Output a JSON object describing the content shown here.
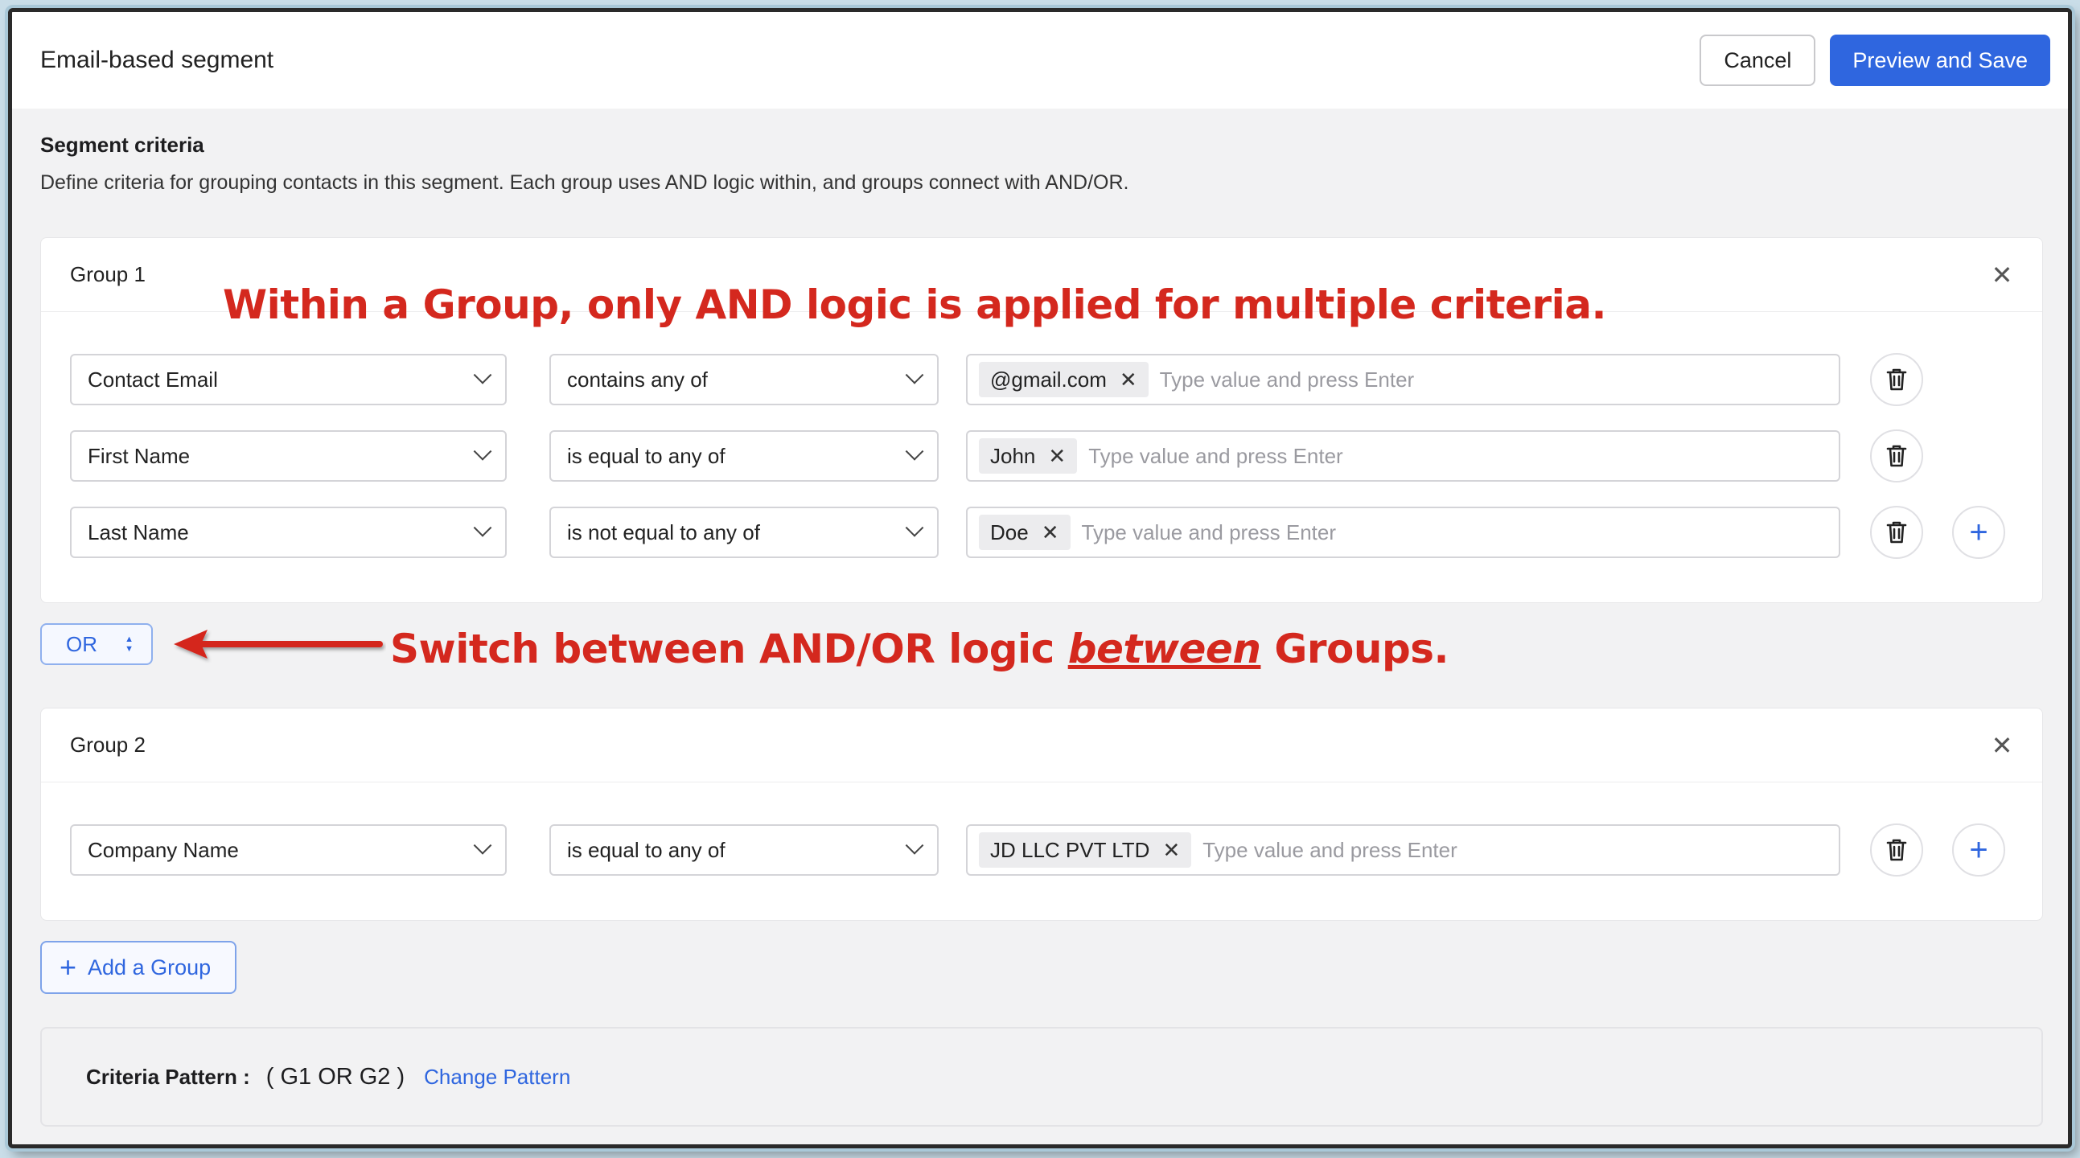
{
  "header": {
    "title": "Email-based segment",
    "cancel_label": "Cancel",
    "save_label": "Preview and Save"
  },
  "criteria": {
    "title": "Segment criteria",
    "description": "Define criteria for grouping contacts in this segment. Each group uses AND logic within, and groups connect with AND/OR."
  },
  "annotations": {
    "within_group": "Within a Group, only AND logic is applied for multiple criteria.",
    "between_prefix": "Switch between AND/OR logic ",
    "between_emphasis": "between",
    "between_suffix": " Groups."
  },
  "groups": [
    {
      "label": "Group 1",
      "rows": [
        {
          "field": "Contact Email",
          "operator": "contains any of",
          "tag": "@gmail.com",
          "placeholder": "Type value and press Enter"
        },
        {
          "field": "First Name",
          "operator": "is equal to any of",
          "tag": "John",
          "placeholder": "Type value and press Enter"
        },
        {
          "field": "Last Name",
          "operator": "is not equal to any of",
          "tag": "Doe",
          "placeholder": "Type value and press Enter"
        }
      ]
    },
    {
      "label": "Group 2",
      "rows": [
        {
          "field": "Company Name",
          "operator": "is equal to any of",
          "tag": "JD LLC PVT LTD",
          "placeholder": "Type value and press Enter"
        }
      ]
    }
  ],
  "logic_toggle": {
    "value": "OR"
  },
  "add_group_label": "Add a Group",
  "pattern": {
    "label": "Criteria Pattern :",
    "value": "( G1 OR G2 )",
    "change_label": "Change Pattern"
  },
  "colors": {
    "primary": "#2f66df",
    "annotation": "#d4281e"
  }
}
